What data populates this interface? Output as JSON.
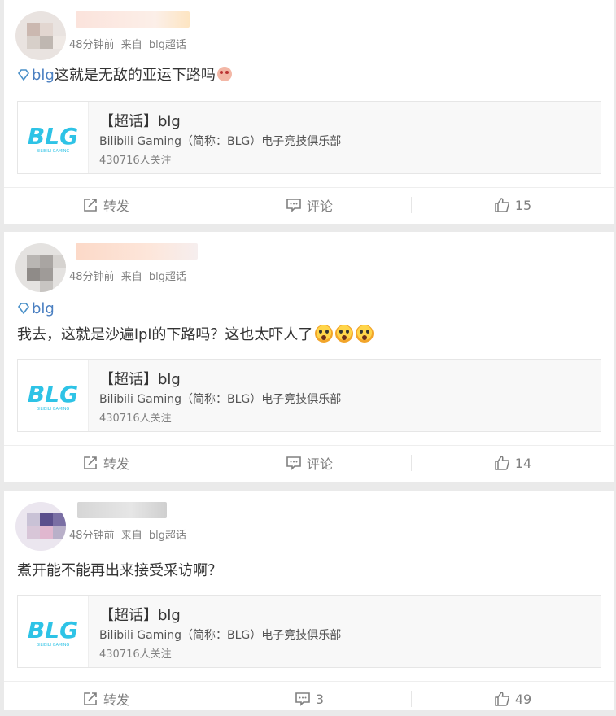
{
  "posts": [
    {
      "meta": {
        "time": "48分钟前",
        "from": "来自",
        "source": "blg超话"
      },
      "tag": "blg",
      "text": "这就是无敌的亚运下路吗",
      "card": {
        "title": "【超话】blg",
        "subtitle": "Bilibili Gaming（简称：BLG）电子竞技俱乐部",
        "fans": "430716人关注",
        "logo_text": "BLG",
        "logo_sub": "BILIBILI GAMING"
      },
      "actions": {
        "repost": "转发",
        "comment": "评论",
        "like": "15"
      }
    },
    {
      "meta": {
        "time": "48分钟前",
        "from": "来自",
        "source": "blg超话"
      },
      "tag": "blg",
      "text": "我去，这就是沙遍lpl的下路吗？这也太吓人了",
      "card": {
        "title": "【超话】blg",
        "subtitle": "Bilibili Gaming（简称：BLG）电子竞技俱乐部",
        "fans": "430716人关注",
        "logo_text": "BLG",
        "logo_sub": "BILIBILI GAMING"
      },
      "actions": {
        "repost": "转发",
        "comment": "评论",
        "like": "14"
      }
    },
    {
      "meta": {
        "time": "48分钟前",
        "from": "来自",
        "source": "blg超话"
      },
      "text": "煮开能不能再出来接受采访啊？",
      "card": {
        "title": "【超话】blg",
        "subtitle": "Bilibili Gaming（简称：BLG）电子竞技俱乐部",
        "fans": "430716人关注",
        "logo_text": "BLG",
        "logo_sub": "BILIBILI GAMING"
      },
      "actions": {
        "repost": "转发",
        "comment": "3",
        "like": "49"
      }
    }
  ],
  "colors": {
    "accent": "#eb7350",
    "logo": "#2ec3e6",
    "meta": "#808080"
  }
}
